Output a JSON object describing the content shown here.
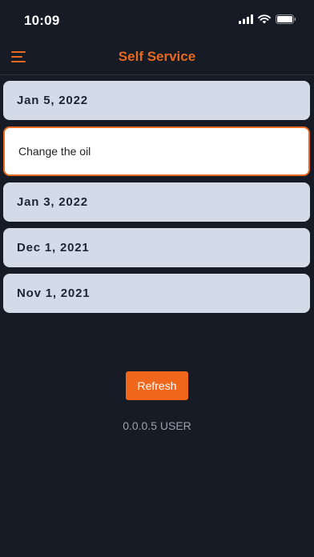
{
  "status_bar": {
    "time": "10:09"
  },
  "header": {
    "title": "Self Service",
    "menu_icon": "hamburger-menu-icon",
    "accent_color": "#e8691e"
  },
  "list": {
    "items": [
      {
        "label": "Jan 5, 2022",
        "expanded": false
      },
      {
        "label": "Change the oil",
        "expanded": true
      },
      {
        "label": "Jan 3, 2022",
        "expanded": false
      },
      {
        "label": "Dec 1, 2021",
        "expanded": false
      },
      {
        "label": "Nov 1, 2021",
        "expanded": false
      }
    ]
  },
  "actions": {
    "refresh_label": "Refresh"
  },
  "footer": {
    "version": "0.0.0.5 USER"
  }
}
